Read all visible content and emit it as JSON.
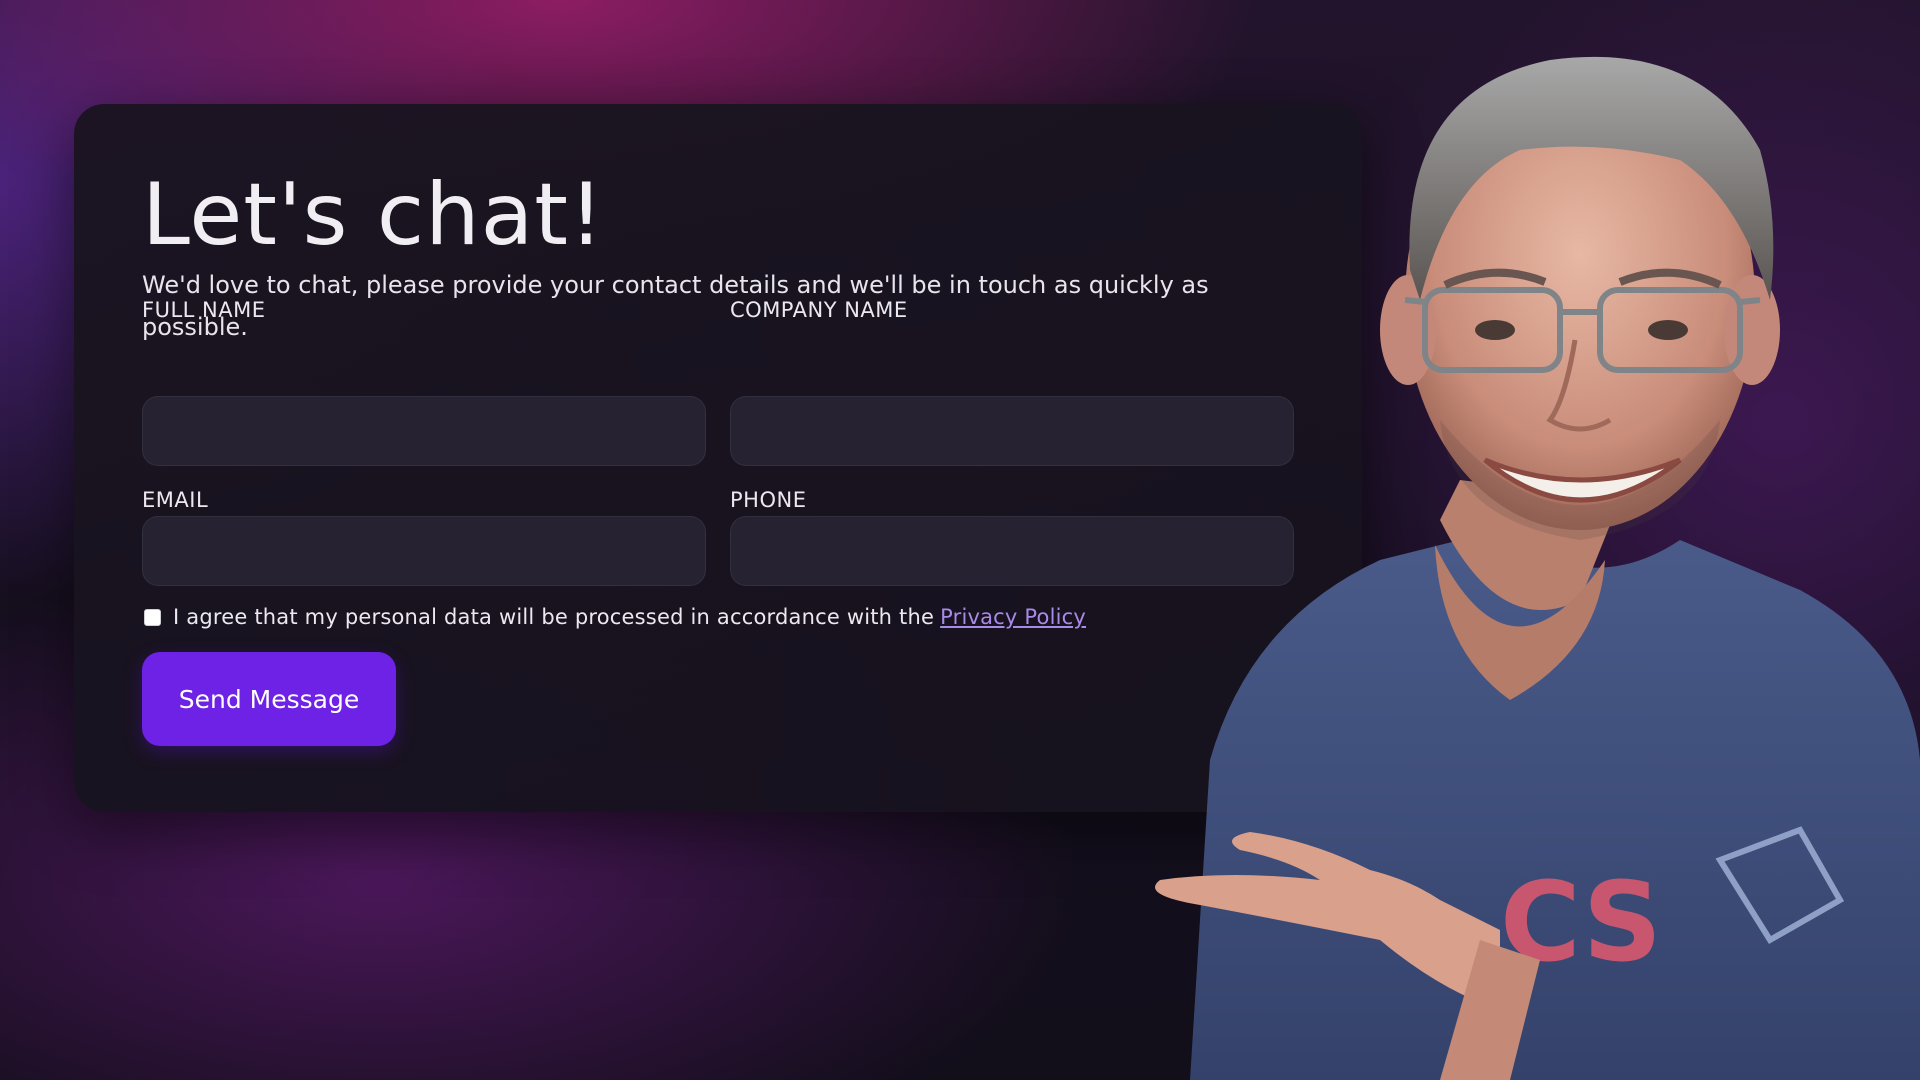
{
  "form": {
    "title": "Let's chat!",
    "subtitle": "We'd love to chat, please provide your contact details and we'll be in touch as quickly as possible.",
    "fields": {
      "full_name": {
        "label": "FULL NAME",
        "value": "",
        "placeholder": ""
      },
      "company_name": {
        "label": "COMPANY NAME",
        "value": "",
        "placeholder": ""
      },
      "email": {
        "label": "EMAIL",
        "value": "",
        "placeholder": ""
      },
      "phone": {
        "label": "PHONE",
        "value": "",
        "placeholder": ""
      }
    },
    "consent": {
      "text": "I agree that my personal data will be processed in accordance with the",
      "link_text": "Privacy Policy",
      "checked": false
    },
    "submit_label": "Send Message"
  },
  "colors": {
    "accent": "#6d22e6",
    "link": "#a88ae8",
    "card_bg": "#1a1420",
    "input_bg": "#262232",
    "text": "#ece8f0"
  },
  "presenter": {
    "description_icon": "person-photo"
  }
}
